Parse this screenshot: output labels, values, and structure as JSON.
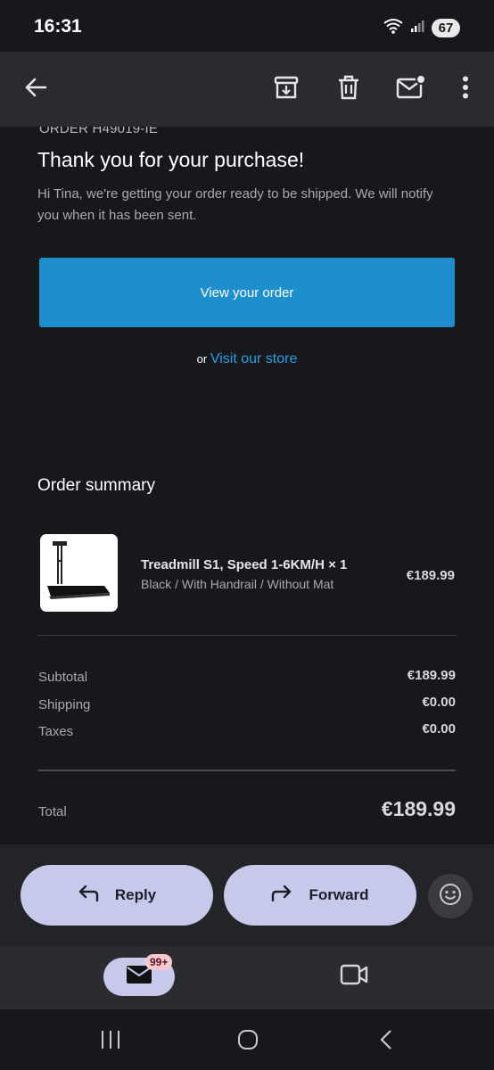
{
  "status_bar": {
    "time": "16:31",
    "battery": "67"
  },
  "app_bar": {
    "icons": [
      "back-arrow-icon",
      "archive-icon",
      "trash-icon",
      "mark-unread-icon",
      "more-vert-icon"
    ]
  },
  "email": {
    "order_number": "ORDER H49019-IE",
    "title": "Thank you for your purchase!",
    "message": "Hi Tina, we're getting your order ready to be shipped. We will notify you when it has been sent.",
    "view_order_label": "View your order",
    "or_text": "or",
    "visit_store_label": "Visit our store",
    "summary_title": "Order summary",
    "item": {
      "name": "Treadmill S1, Speed 1-6KM/H × 1",
      "variant": "Black / With Handrail / Without Mat",
      "price": "€189.99"
    },
    "lines": [
      {
        "label": "Subtotal",
        "value": "€189.99"
      },
      {
        "label": "Shipping",
        "value": "€0.00"
      },
      {
        "label": "Taxes",
        "value": "€0.00"
      }
    ],
    "total_label": "Total",
    "total_value": "€189.99"
  },
  "actions": {
    "reply_label": "Reply",
    "forward_label": "Forward"
  },
  "bottom_nav": {
    "mail_badge": "99+"
  },
  "colors": {
    "accent_button": "#1e8fcc",
    "link": "#2b9fe0",
    "pill": "#c6c9e9"
  }
}
